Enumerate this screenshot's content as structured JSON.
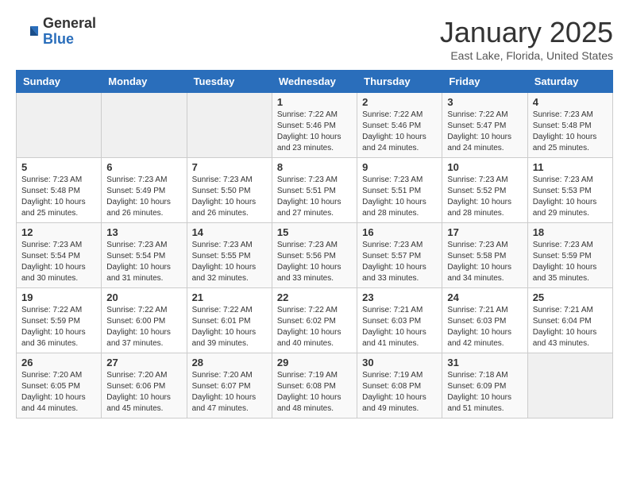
{
  "header": {
    "logo_general": "General",
    "logo_blue": "Blue",
    "month_title": "January 2025",
    "subtitle": "East Lake, Florida, United States"
  },
  "days_of_week": [
    "Sunday",
    "Monday",
    "Tuesday",
    "Wednesday",
    "Thursday",
    "Friday",
    "Saturday"
  ],
  "weeks": [
    [
      {
        "day": "",
        "info": ""
      },
      {
        "day": "",
        "info": ""
      },
      {
        "day": "",
        "info": ""
      },
      {
        "day": "1",
        "info": "Sunrise: 7:22 AM\nSunset: 5:46 PM\nDaylight: 10 hours\nand 23 minutes."
      },
      {
        "day": "2",
        "info": "Sunrise: 7:22 AM\nSunset: 5:46 PM\nDaylight: 10 hours\nand 24 minutes."
      },
      {
        "day": "3",
        "info": "Sunrise: 7:22 AM\nSunset: 5:47 PM\nDaylight: 10 hours\nand 24 minutes."
      },
      {
        "day": "4",
        "info": "Sunrise: 7:23 AM\nSunset: 5:48 PM\nDaylight: 10 hours\nand 25 minutes."
      }
    ],
    [
      {
        "day": "5",
        "info": "Sunrise: 7:23 AM\nSunset: 5:48 PM\nDaylight: 10 hours\nand 25 minutes."
      },
      {
        "day": "6",
        "info": "Sunrise: 7:23 AM\nSunset: 5:49 PM\nDaylight: 10 hours\nand 26 minutes."
      },
      {
        "day": "7",
        "info": "Sunrise: 7:23 AM\nSunset: 5:50 PM\nDaylight: 10 hours\nand 26 minutes."
      },
      {
        "day": "8",
        "info": "Sunrise: 7:23 AM\nSunset: 5:51 PM\nDaylight: 10 hours\nand 27 minutes."
      },
      {
        "day": "9",
        "info": "Sunrise: 7:23 AM\nSunset: 5:51 PM\nDaylight: 10 hours\nand 28 minutes."
      },
      {
        "day": "10",
        "info": "Sunrise: 7:23 AM\nSunset: 5:52 PM\nDaylight: 10 hours\nand 28 minutes."
      },
      {
        "day": "11",
        "info": "Sunrise: 7:23 AM\nSunset: 5:53 PM\nDaylight: 10 hours\nand 29 minutes."
      }
    ],
    [
      {
        "day": "12",
        "info": "Sunrise: 7:23 AM\nSunset: 5:54 PM\nDaylight: 10 hours\nand 30 minutes."
      },
      {
        "day": "13",
        "info": "Sunrise: 7:23 AM\nSunset: 5:54 PM\nDaylight: 10 hours\nand 31 minutes."
      },
      {
        "day": "14",
        "info": "Sunrise: 7:23 AM\nSunset: 5:55 PM\nDaylight: 10 hours\nand 32 minutes."
      },
      {
        "day": "15",
        "info": "Sunrise: 7:23 AM\nSunset: 5:56 PM\nDaylight: 10 hours\nand 33 minutes."
      },
      {
        "day": "16",
        "info": "Sunrise: 7:23 AM\nSunset: 5:57 PM\nDaylight: 10 hours\nand 33 minutes."
      },
      {
        "day": "17",
        "info": "Sunrise: 7:23 AM\nSunset: 5:58 PM\nDaylight: 10 hours\nand 34 minutes."
      },
      {
        "day": "18",
        "info": "Sunrise: 7:23 AM\nSunset: 5:59 PM\nDaylight: 10 hours\nand 35 minutes."
      }
    ],
    [
      {
        "day": "19",
        "info": "Sunrise: 7:22 AM\nSunset: 5:59 PM\nDaylight: 10 hours\nand 36 minutes."
      },
      {
        "day": "20",
        "info": "Sunrise: 7:22 AM\nSunset: 6:00 PM\nDaylight: 10 hours\nand 37 minutes."
      },
      {
        "day": "21",
        "info": "Sunrise: 7:22 AM\nSunset: 6:01 PM\nDaylight: 10 hours\nand 39 minutes."
      },
      {
        "day": "22",
        "info": "Sunrise: 7:22 AM\nSunset: 6:02 PM\nDaylight: 10 hours\nand 40 minutes."
      },
      {
        "day": "23",
        "info": "Sunrise: 7:21 AM\nSunset: 6:03 PM\nDaylight: 10 hours\nand 41 minutes."
      },
      {
        "day": "24",
        "info": "Sunrise: 7:21 AM\nSunset: 6:03 PM\nDaylight: 10 hours\nand 42 minutes."
      },
      {
        "day": "25",
        "info": "Sunrise: 7:21 AM\nSunset: 6:04 PM\nDaylight: 10 hours\nand 43 minutes."
      }
    ],
    [
      {
        "day": "26",
        "info": "Sunrise: 7:20 AM\nSunset: 6:05 PM\nDaylight: 10 hours\nand 44 minutes."
      },
      {
        "day": "27",
        "info": "Sunrise: 7:20 AM\nSunset: 6:06 PM\nDaylight: 10 hours\nand 45 minutes."
      },
      {
        "day": "28",
        "info": "Sunrise: 7:20 AM\nSunset: 6:07 PM\nDaylight: 10 hours\nand 47 minutes."
      },
      {
        "day": "29",
        "info": "Sunrise: 7:19 AM\nSunset: 6:08 PM\nDaylight: 10 hours\nand 48 minutes."
      },
      {
        "day": "30",
        "info": "Sunrise: 7:19 AM\nSunset: 6:08 PM\nDaylight: 10 hours\nand 49 minutes."
      },
      {
        "day": "31",
        "info": "Sunrise: 7:18 AM\nSunset: 6:09 PM\nDaylight: 10 hours\nand 51 minutes."
      },
      {
        "day": "",
        "info": ""
      }
    ]
  ]
}
